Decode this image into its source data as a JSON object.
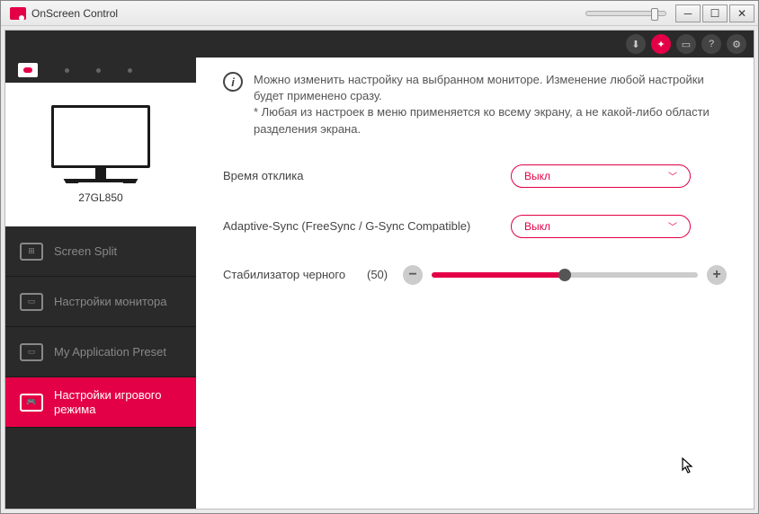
{
  "window": {
    "title": "OnScreen Control"
  },
  "monitor": {
    "name": "27GL850"
  },
  "nav": {
    "items": [
      {
        "label": "Screen Split"
      },
      {
        "label": "Настройки монитора"
      },
      {
        "label": "My Application Preset"
      },
      {
        "label": "Настройки игрового режима"
      }
    ]
  },
  "info": {
    "line1": "Можно изменить настройку на выбранном мониторе. Изменение любой настройки будет применено сразу.",
    "line2": "* Любая из настроек в меню применяется ко всему экрану, а не какой-либо области разделения экрана."
  },
  "settings": {
    "response_time": {
      "label": "Время отклика",
      "value": "Выкл"
    },
    "adaptive_sync": {
      "label": "Adaptive-Sync (FreeSync / G-Sync Compatible)",
      "value": "Выкл"
    },
    "black_stabilizer": {
      "label": "Стабилизатор черного",
      "value_display": "(50)",
      "value": 50,
      "min": 0,
      "max": 100
    }
  },
  "colors": {
    "accent": "#e40046"
  }
}
